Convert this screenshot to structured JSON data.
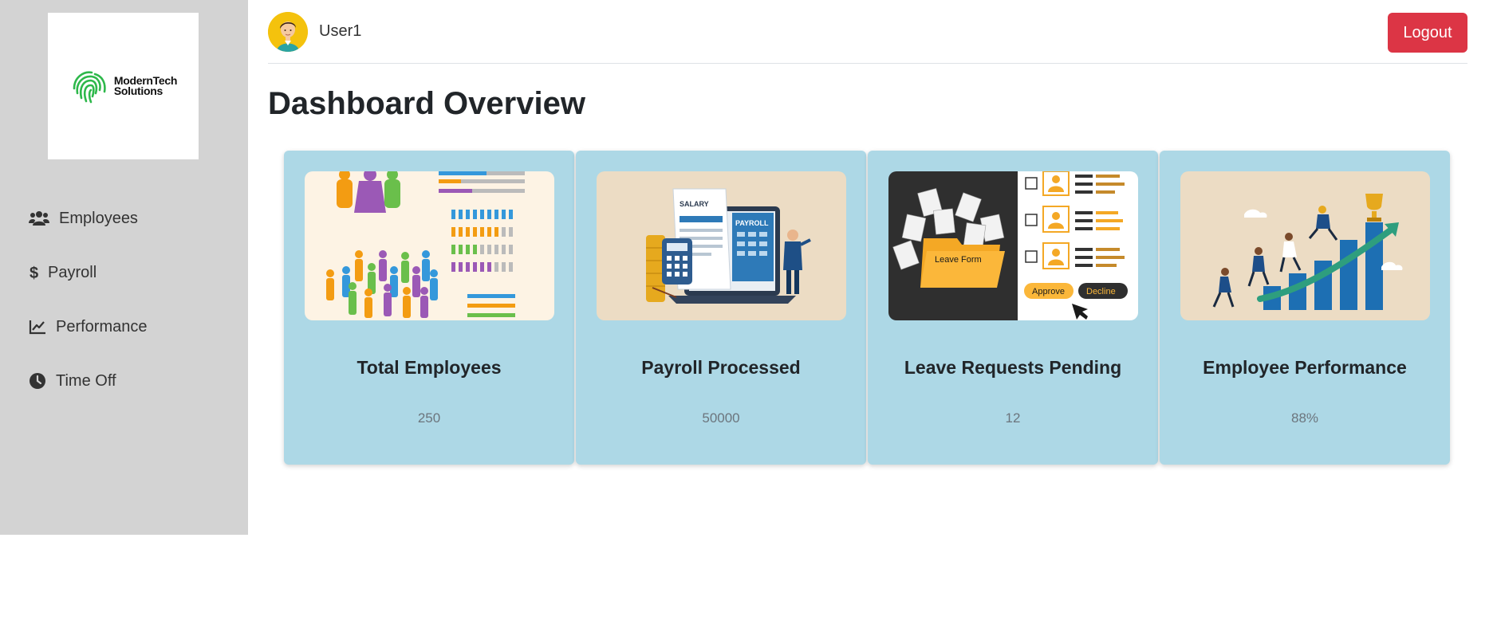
{
  "sidebar": {
    "logo": {
      "line1": "ModernTech",
      "line2": "Solutions"
    },
    "items": [
      {
        "label": "Employees",
        "icon": "users-icon"
      },
      {
        "label": "Payroll",
        "icon": "dollar-icon"
      },
      {
        "label": "Performance",
        "icon": "line-chart-icon"
      },
      {
        "label": "Time Off",
        "icon": "clock-icon"
      }
    ]
  },
  "header": {
    "username": "User1",
    "logout_label": "Logout"
  },
  "main": {
    "title": "Dashboard Overview"
  },
  "cards": [
    {
      "title": "Total Employees",
      "value": "250"
    },
    {
      "title": "Payroll Processed",
      "value": "50000"
    },
    {
      "title": "Leave Requests Pending",
      "value": "12"
    },
    {
      "title": "Employee Performance",
      "value": "88%"
    }
  ],
  "illustrations": {
    "leave": {
      "form": "Leave Form",
      "approve": "Approve",
      "decline": "Decline"
    },
    "payroll": {
      "salary": "SALARY",
      "payroll": "PAYROLL"
    }
  },
  "colors": {
    "sidebar": "#d3d3d3",
    "card": "#add8e6",
    "logout": "#dc3545",
    "logo_green": "#2eb84b"
  }
}
